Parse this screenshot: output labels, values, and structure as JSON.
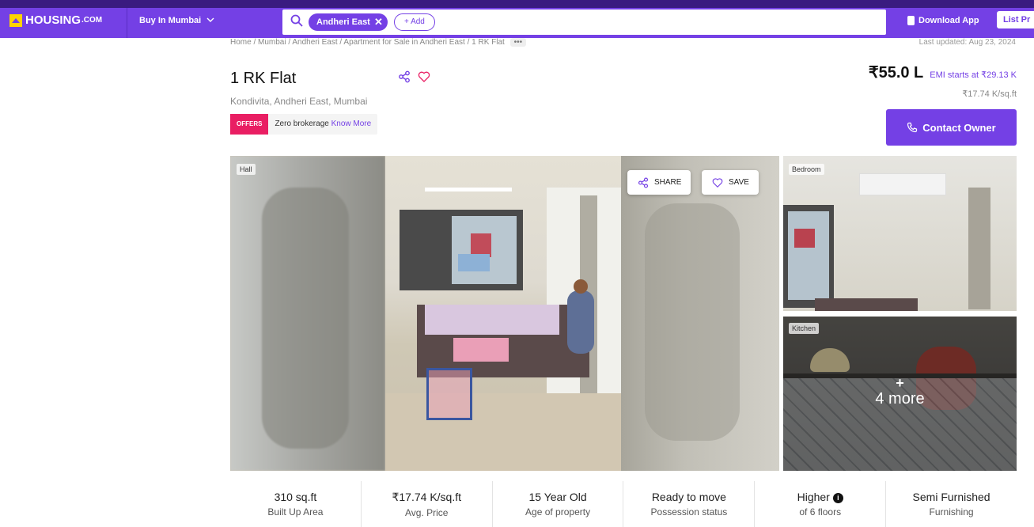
{
  "header": {
    "brand": "HOUSING",
    "brand_suffix": ".COM",
    "city_selector": "Buy In Mumbai",
    "search_chip": "Andheri East",
    "add_label": "+ Add",
    "download_app": "Download App",
    "list_property": "List Pr"
  },
  "breadcrumb": {
    "path": "Home / Mumbai / Andheri East / Apartment for Sale in Andheri East / 1 RK Flat",
    "more": "•••"
  },
  "last_updated": "Last updated: Aug 23, 2024",
  "listing": {
    "title": "1 RK Flat",
    "locality": "Kondivita, Andheri East, Mumbai",
    "offer_tag": "OFFERS",
    "offer_text": "Zero brokerage",
    "offer_link": "Know More",
    "price": "₹55.0 L",
    "emi": "EMI starts at ₹29.13 K",
    "price_per_sqft": "₹17.74 K/sq.ft",
    "contact_button": "Contact Owner"
  },
  "gallery": {
    "hall_label": "Hall",
    "share_label": "SHARE",
    "save_label": "SAVE",
    "bedroom_label": "Bedroom",
    "kitchen_label": "Kitchen",
    "more_plus": "+",
    "more_label": "4 more"
  },
  "stats": [
    {
      "value": "310 sq.ft",
      "label": "Built Up Area"
    },
    {
      "value": "₹17.74 K/sq.ft",
      "label": "Avg. Price"
    },
    {
      "value": "15 Year Old",
      "label": "Age of property"
    },
    {
      "value": "Ready to move",
      "label": "Possession status"
    },
    {
      "value": "Higher",
      "label": "of 6 floors"
    },
    {
      "value": "Semi Furnished",
      "label": "Furnishing"
    }
  ],
  "colors": {
    "brand_purple": "#7440e5",
    "offer_pink": "#e91e63",
    "logo_yellow": "#ffd400"
  }
}
